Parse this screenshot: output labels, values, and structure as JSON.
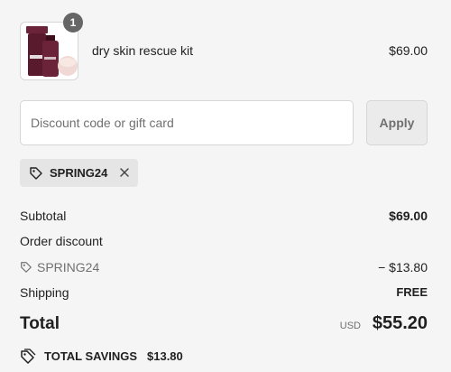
{
  "line_item": {
    "quantity": "1",
    "name": "dry skin rescue kit",
    "price": "$69.00",
    "image_desc_icon": "product-thumbnail"
  },
  "discount": {
    "placeholder": "Discount code or gift card",
    "value": "",
    "apply_label": "Apply",
    "applied_code": "SPRING24"
  },
  "summary": {
    "subtotal_label": "Subtotal",
    "subtotal_value": "$69.00",
    "order_discount_label": "Order discount",
    "discount_code": "SPRING24",
    "discount_value": "− $13.80",
    "shipping_label": "Shipping",
    "shipping_value": "FREE",
    "total_label": "Total",
    "total_currency": "USD",
    "total_value": "$55.20",
    "savings_label": "TOTAL SAVINGS",
    "savings_value": "$13.80"
  },
  "colors": {
    "background": "#f5f5f5",
    "text": "#1f1f1f",
    "muted": "#707070",
    "badge": "#666666",
    "product_plum": "#5a1a2e"
  }
}
